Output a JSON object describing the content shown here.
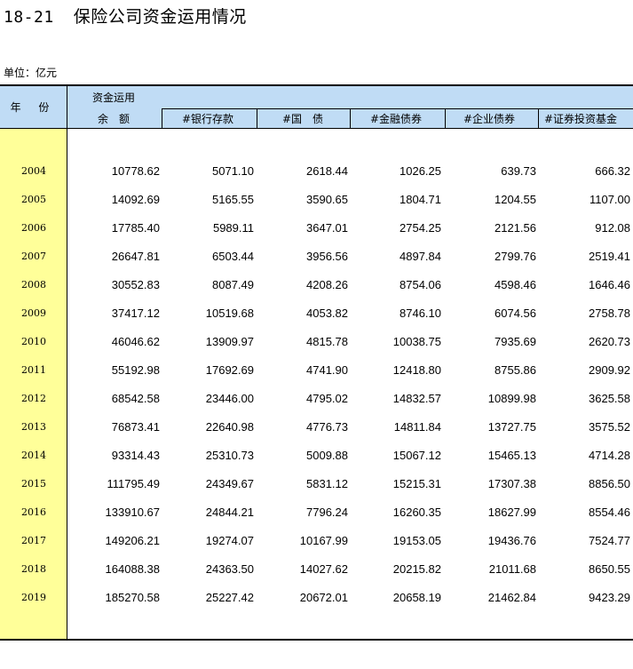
{
  "header": {
    "table_number": "18-21",
    "title": "保险公司资金运用情况",
    "unit": "单位：亿元"
  },
  "table": {
    "year_header": "年 份",
    "group_header": "资金运用",
    "columns": [
      "余　额",
      "#银行存款",
      "#国　债",
      "#金融债券",
      "#企业债券",
      "#证券投资基金"
    ],
    "rows": [
      {
        "year": "2004",
        "values": [
          "10778.62",
          "5071.10",
          "2618.44",
          "1026.25",
          "639.73",
          "666.32"
        ]
      },
      {
        "year": "2005",
        "values": [
          "14092.69",
          "5165.55",
          "3590.65",
          "1804.71",
          "1204.55",
          "1107.00"
        ]
      },
      {
        "year": "2006",
        "values": [
          "17785.40",
          "5989.11",
          "3647.01",
          "2754.25",
          "2121.56",
          "912.08"
        ]
      },
      {
        "year": "2007",
        "values": [
          "26647.81",
          "6503.44",
          "3956.56",
          "4897.84",
          "2799.76",
          "2519.41"
        ]
      },
      {
        "year": "2008",
        "values": [
          "30552.83",
          "8087.49",
          "4208.26",
          "8754.06",
          "4598.46",
          "1646.46"
        ]
      },
      {
        "year": "2009",
        "values": [
          "37417.12",
          "10519.68",
          "4053.82",
          "8746.10",
          "6074.56",
          "2758.78"
        ]
      },
      {
        "year": "2010",
        "values": [
          "46046.62",
          "13909.97",
          "4815.78",
          "10038.75",
          "7935.69",
          "2620.73"
        ]
      },
      {
        "year": "2011",
        "values": [
          "55192.98",
          "17692.69",
          "4741.90",
          "12418.80",
          "8755.86",
          "2909.92"
        ]
      },
      {
        "year": "2012",
        "values": [
          "68542.58",
          "23446.00",
          "4795.02",
          "14832.57",
          "10899.98",
          "3625.58"
        ]
      },
      {
        "year": "2013",
        "values": [
          "76873.41",
          "22640.98",
          "4776.73",
          "14811.84",
          "13727.75",
          "3575.52"
        ]
      },
      {
        "year": "2014",
        "values": [
          "93314.43",
          "25310.73",
          "5009.88",
          "15067.12",
          "15465.13",
          "4714.28"
        ]
      },
      {
        "year": "2015",
        "values": [
          "111795.49",
          "24349.67",
          "5831.12",
          "15215.31",
          "17307.38",
          "8856.50"
        ]
      },
      {
        "year": "2016",
        "values": [
          "133910.67",
          "24844.21",
          "7796.24",
          "16260.35",
          "18627.99",
          "8554.46"
        ]
      },
      {
        "year": "2017",
        "values": [
          "149206.21",
          "19274.07",
          "10167.99",
          "19153.05",
          "19436.76",
          "7524.77"
        ]
      },
      {
        "year": "2018",
        "values": [
          "164088.38",
          "24363.50",
          "14027.62",
          "20215.82",
          "21011.68",
          "8650.55"
        ]
      },
      {
        "year": "2019",
        "values": [
          "185270.58",
          "25227.42",
          "20672.01",
          "20658.19",
          "21462.84",
          "9423.29"
        ]
      }
    ]
  },
  "colors": {
    "header_bg": "#c0dcf5",
    "year_column_bg": "#ffff99"
  }
}
